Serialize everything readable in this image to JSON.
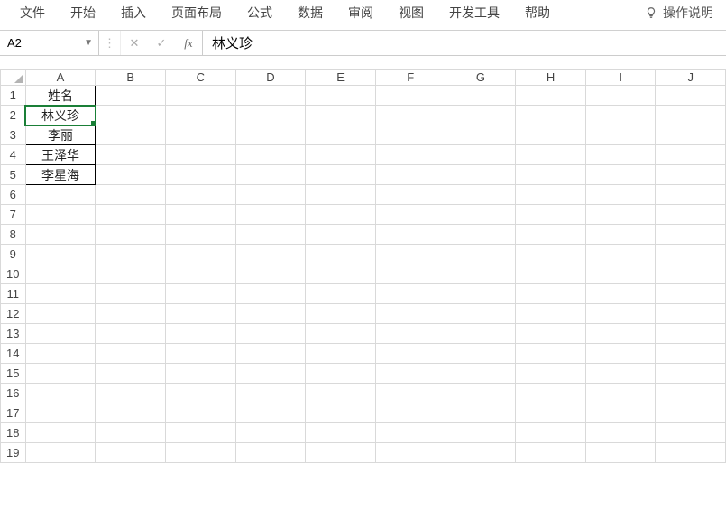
{
  "ribbon": {
    "tabs": [
      "文件",
      "开始",
      "插入",
      "页面布局",
      "公式",
      "数据",
      "审阅",
      "视图",
      "开发工具",
      "帮助"
    ],
    "hint": "操作说明"
  },
  "formula_bar": {
    "name_box": "A2",
    "cancel_glyph": "✕",
    "confirm_glyph": "✓",
    "fx_label": "fx",
    "value": "林义珍"
  },
  "grid": {
    "columns": [
      "A",
      "B",
      "C",
      "D",
      "E",
      "F",
      "G",
      "H",
      "I",
      "J"
    ],
    "row_count": 19,
    "selected": {
      "row": 2,
      "col": "A"
    },
    "data": {
      "A1": "姓名",
      "A2": "林义珍",
      "A3": "李丽",
      "A4": "王泽华",
      "A5": "李星海"
    },
    "bordered_cells": [
      "A1",
      "A2",
      "A3",
      "A4",
      "A5"
    ]
  }
}
